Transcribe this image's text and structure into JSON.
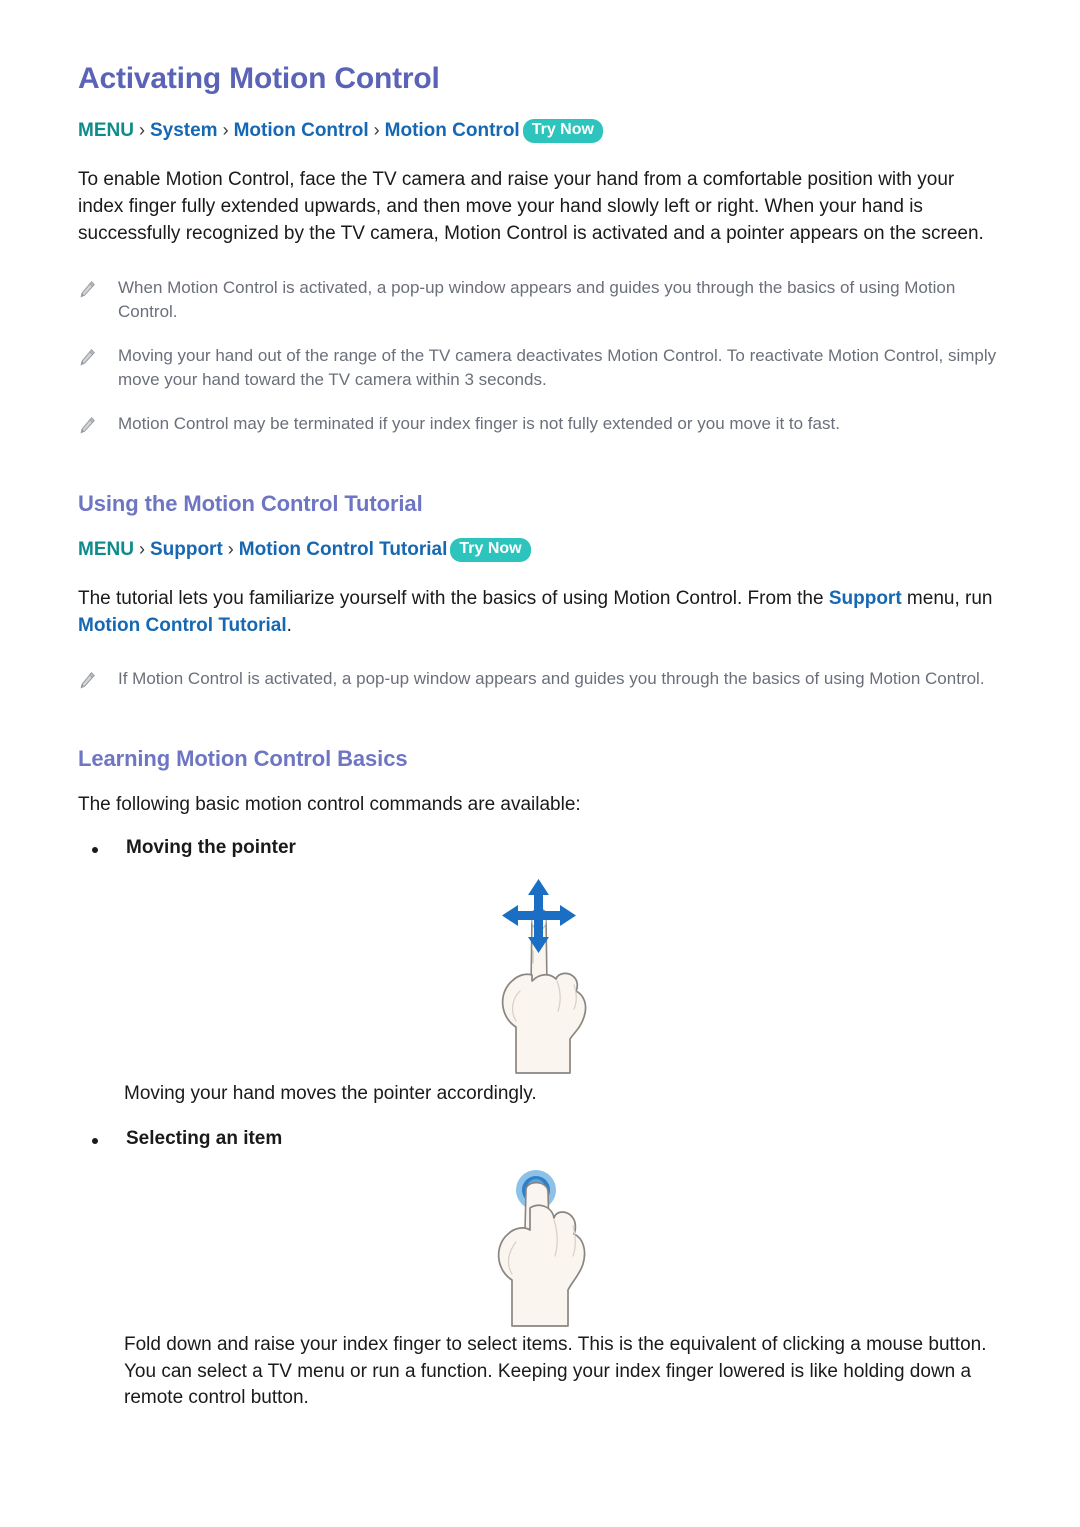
{
  "document": {
    "title": "Activating Motion Control"
  },
  "colors": {
    "title": "#5b63b7",
    "section_title": "#6e76c4",
    "breadcrumb_menu": "#0e8c8c",
    "breadcrumb_item": "#1668b3",
    "try_now_badge": "#2cc4bd",
    "link": "#1668b3",
    "note_text": "#6a6f7a",
    "body_text": "#1a1a1a",
    "hand_fill": "#faf5ef",
    "hand_outline": "#8a8580",
    "arrow_blue": "#1a6fc4",
    "tap_circle": "#2f7fc9"
  },
  "section1": {
    "heading": "Activating Motion Control",
    "breadcrumb": {
      "menu": "MENU",
      "sep": "›",
      "items": [
        "System",
        "Motion Control",
        "Motion Control"
      ],
      "badge": "Try Now"
    },
    "paragraph": "To enable Motion Control, face the TV camera and raise your hand from a comfortable position with your index finger fully extended upwards, and then move your hand slowly left or right. When your hand is successfully recognized by the TV camera, Motion Control is activated and a pointer appears on the screen.",
    "notes": [
      "When Motion Control is activated, a pop-up window appears and guides you through the basics of using Motion Control.",
      "Moving your hand out of the range of the TV camera deactivates Motion Control. To reactivate Motion Control, simply move your hand toward the TV camera within 3 seconds.",
      "Motion Control may be terminated if your index finger is not fully extended or you move it to fast."
    ]
  },
  "section2": {
    "heading": "Using the Motion Control Tutorial",
    "breadcrumb": {
      "menu": "MENU",
      "sep": "›",
      "items": [
        "Support",
        "Motion Control Tutorial"
      ],
      "badge": "Try Now"
    },
    "paragraph": {
      "part1": "The tutorial lets you familiarize yourself with the basics of using Motion Control. From the ",
      "link1": "Support",
      "part2": " menu, run ",
      "link2": "Motion Control Tutorial",
      "part3": "."
    },
    "notes": [
      "If Motion Control is activated, a pop-up window appears and guides you through the basics of using Motion Control."
    ]
  },
  "section3": {
    "heading": "Learning Motion Control Basics",
    "intro": "The following basic motion control commands are available:",
    "items": [
      {
        "label": "Moving the pointer",
        "figure": "hand-pointing-with-four-way-arrow",
        "caption": "Moving your hand moves the pointer accordingly."
      },
      {
        "label": "Selecting an item",
        "figure": "hand-folded-with-tap-circle",
        "caption": "Fold down and raise your index finger to select items. This is the equivalent of clicking a mouse button. You can select a TV menu or run a function. Keeping your index finger lowered is like holding down a remote control button."
      }
    ]
  }
}
